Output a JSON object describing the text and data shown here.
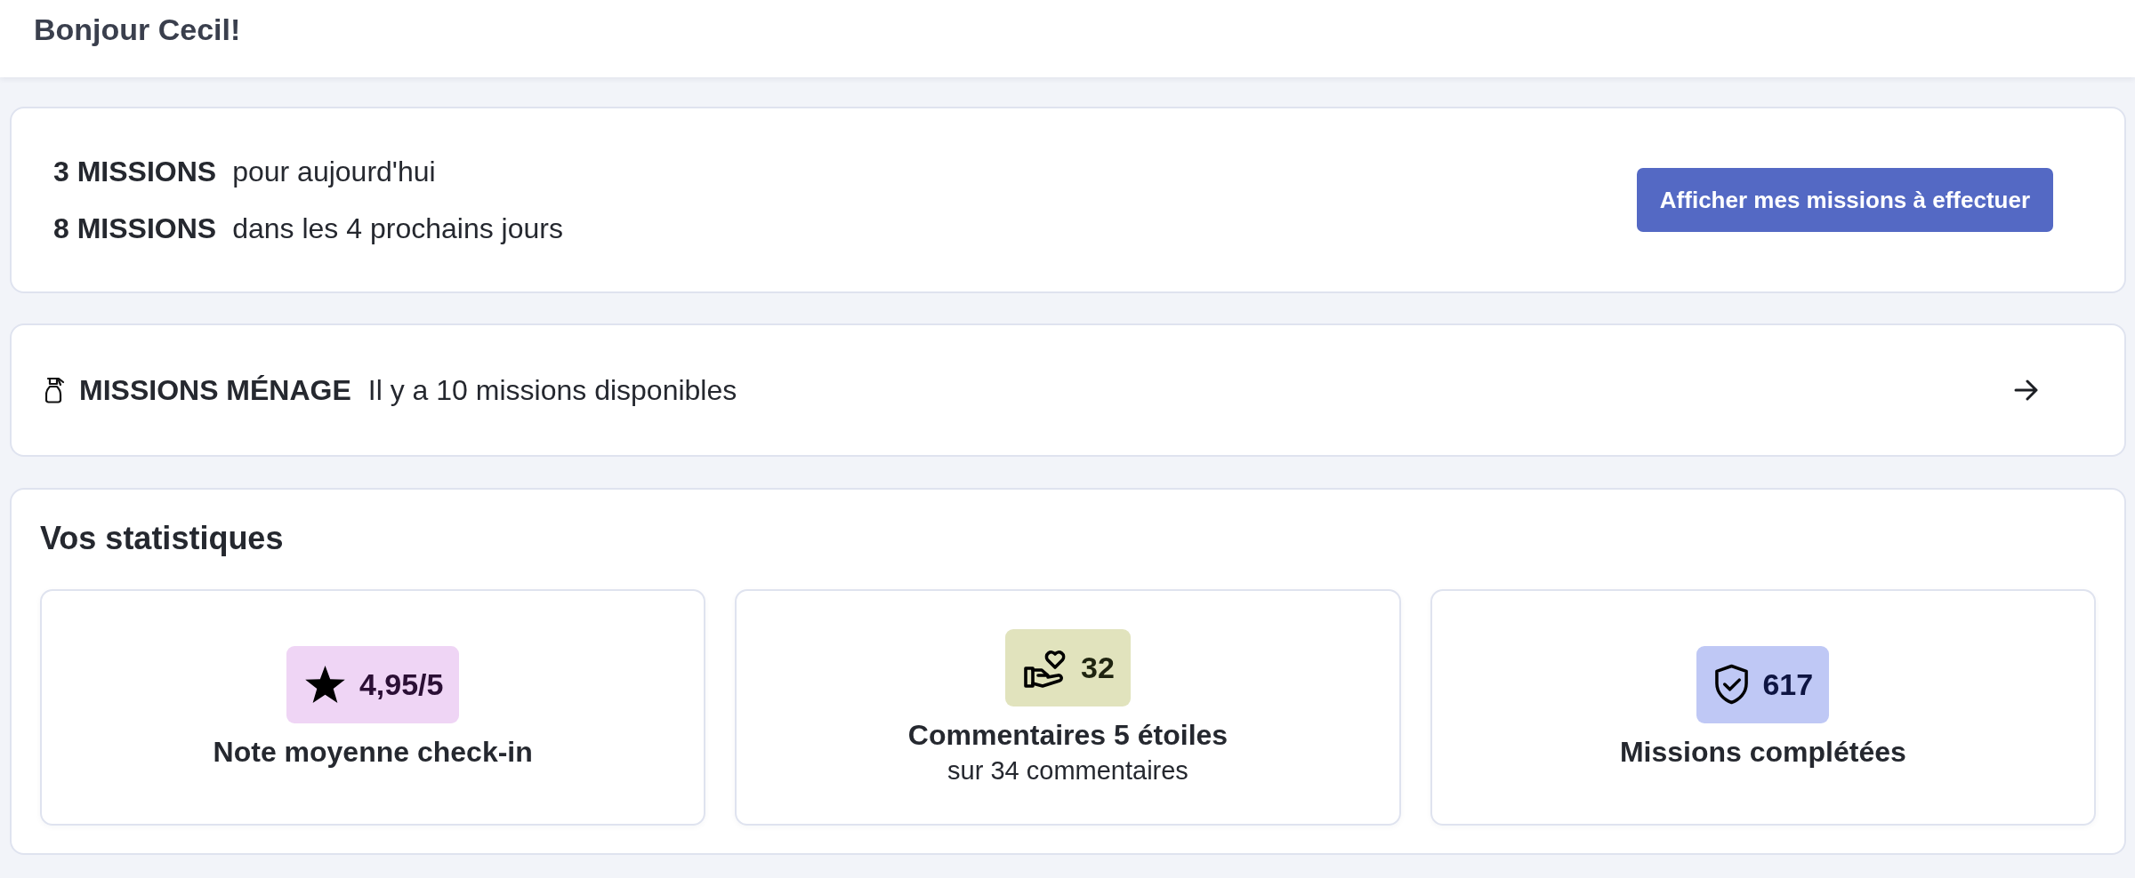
{
  "header": {
    "title": "Bonjour Cecil!"
  },
  "missions_summary": {
    "lines": [
      {
        "count": "3 MISSIONS",
        "text": "pour aujourd'hui"
      },
      {
        "count": "8 MISSIONS",
        "text": "dans les 4 prochains jours"
      }
    ],
    "button": "Afficher mes missions à effectuer"
  },
  "category_card": {
    "title": "MISSIONS MÉNAGE",
    "text": "Il y a 10 missions disponibles"
  },
  "statistics": {
    "title": "Vos statistiques",
    "cards": [
      {
        "kind": "rating",
        "value": "4,95/5",
        "color": "#efd5f5",
        "label": "Note moyenne check-in"
      },
      {
        "kind": "reviews",
        "value": "32",
        "color": "#e1e3bd",
        "label": "Commentaires 5 étoiles",
        "sublabel": "sur 34 commentaires"
      },
      {
        "kind": "completed",
        "value": "617",
        "color": "#bfc8f5",
        "label": "Missions complétées"
      }
    ]
  }
}
